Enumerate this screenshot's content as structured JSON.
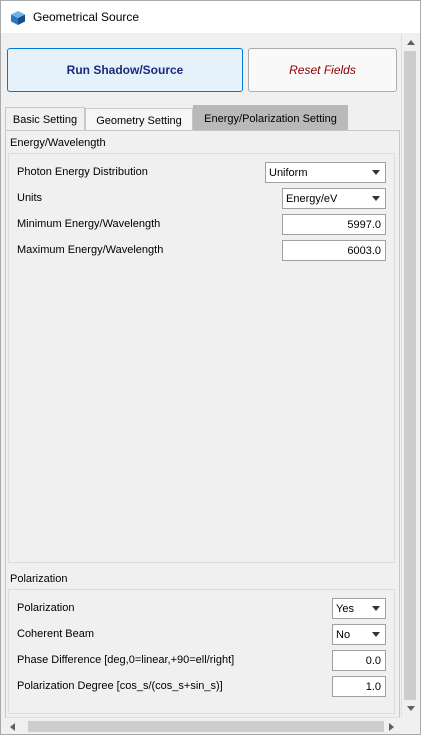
{
  "window": {
    "title": "Geometrical Source",
    "icon": "cube-icon"
  },
  "buttons": {
    "run": "Run Shadow/Source",
    "reset": "Reset Fields"
  },
  "tabs": [
    {
      "label": "Basic Setting",
      "active": false
    },
    {
      "label": "Geometry Setting",
      "active": false
    },
    {
      "label": "Energy/Polarization Setting",
      "active": true
    }
  ],
  "energy": {
    "section_title": "Energy/Wavelength",
    "photon_distribution": {
      "label": "Photon Energy Distribution",
      "value": "Uniform"
    },
    "units": {
      "label": "Units",
      "value": "Energy/eV"
    },
    "min": {
      "label": "Minimum Energy/Wavelength",
      "value": "5997.0"
    },
    "max": {
      "label": "Maximum Energy/Wavelength",
      "value": "6003.0"
    }
  },
  "polarization": {
    "section_title": "Polarization",
    "polarization": {
      "label": "Polarization",
      "value": "Yes"
    },
    "coherent": {
      "label": "Coherent Beam",
      "value": "No"
    },
    "phase": {
      "label": "Phase Difference [deg,0=linear,+90=ell/right]",
      "value": "0.0"
    },
    "degree": {
      "label": "Polarization Degree [cos_s/(cos_s+sin_s)]",
      "value": "1.0"
    }
  },
  "colors": {
    "run_text": "#1c2a7a",
    "reset_text": "#8b0000",
    "active_tab": "#b9b9b9",
    "accent_border": "#0078d7"
  }
}
